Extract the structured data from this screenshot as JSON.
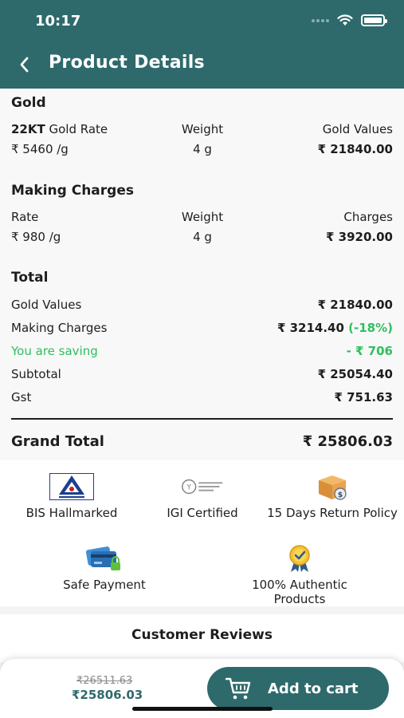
{
  "status_bar": {
    "time": "10:17"
  },
  "header": {
    "title": "Product Details"
  },
  "gold": {
    "title": "Gold",
    "rate_label_bold": "22KT",
    "rate_label": " Gold Rate",
    "weight_label": "Weight",
    "values_label": "Gold Values",
    "rate": "₹ 5460 /g",
    "weight": "4 g",
    "value": "₹ 21840.00"
  },
  "making": {
    "title": "Making Charges",
    "rate_label": "Rate",
    "weight_label": "Weight",
    "charges_label": "Charges",
    "rate": "₹ 980 /g",
    "weight": "4 g",
    "charges": "₹ 3920.00"
  },
  "total": {
    "title": "Total",
    "rows": [
      {
        "label": "Gold Values",
        "value": "₹ 21840.00"
      },
      {
        "label": "Making Charges",
        "value": "₹ 3214.40",
        "note": "(-18%)"
      },
      {
        "label": "You are saving",
        "value": "- ₹ 706"
      },
      {
        "label": "Subtotal",
        "value": "₹ 25054.40"
      },
      {
        "label": "Gst",
        "value": "₹ 751.63"
      }
    ],
    "grand_label": "Grand Total",
    "grand_value": "₹ 25806.03"
  },
  "features": [
    {
      "label": "BIS Hallmarked",
      "icon": "bis-logo-icon"
    },
    {
      "label": "IGI Certified",
      "icon": "igi-logo-icon"
    },
    {
      "label": "15 Days Return Policy",
      "icon": "return-box-icon"
    },
    {
      "label": "Safe Payment",
      "icon": "credit-card-lock-icon"
    },
    {
      "label": "100% Authentic Products",
      "icon": "authentic-badge-icon"
    }
  ],
  "reviews": {
    "title": "Customer Reviews"
  },
  "bottom_bar": {
    "old_price": "₹26511.63",
    "new_price": "₹25806.03",
    "cart_label": "Add to cart"
  },
  "colors": {
    "brand": "#2e6a6c",
    "saving_green": "#2fbf5f"
  }
}
